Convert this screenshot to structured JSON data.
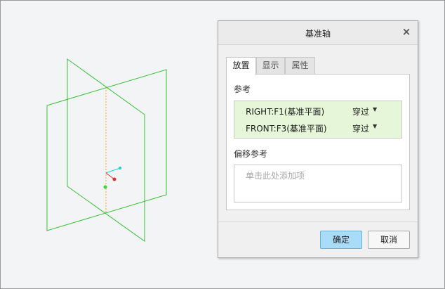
{
  "dialog": {
    "title": "基准轴",
    "close_glyph": "×",
    "tabs": [
      {
        "label": "放置",
        "active": true
      },
      {
        "label": "显示",
        "active": false
      },
      {
        "label": "属性",
        "active": false
      }
    ],
    "references_label": "参考",
    "references": [
      {
        "name": "RIGHT:F1(基准平面)",
        "constraint": "穿过"
      },
      {
        "name": "FRONT:F3(基准平面)",
        "constraint": "穿过"
      }
    ],
    "offset_label": "偏移参考",
    "offset_placeholder": "单击此处添加项",
    "ok_label": "确定",
    "cancel_label": "取消"
  },
  "colors": {
    "plane": "#35c035",
    "axis": "#f5a040",
    "ok_button": "#a9dcf7",
    "reference_list_bg": "#e6f6d8"
  }
}
